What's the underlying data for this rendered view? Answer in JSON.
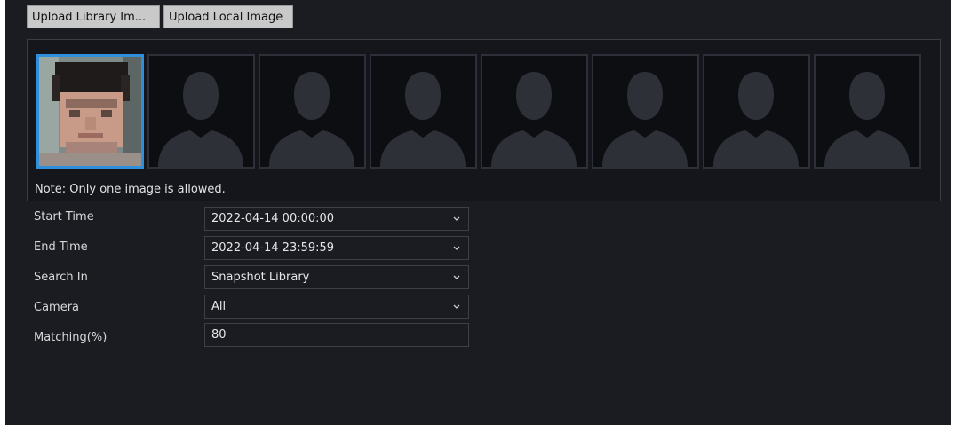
{
  "toolbar": {
    "upload_library_label": "Upload Library Im...",
    "upload_local_label": "Upload Local Image"
  },
  "gallery": {
    "note": "Note: Only one image is allowed.",
    "slots": [
      {
        "state": "selected-face"
      },
      {
        "state": "empty"
      },
      {
        "state": "empty"
      },
      {
        "state": "empty"
      },
      {
        "state": "empty"
      },
      {
        "state": "empty"
      },
      {
        "state": "empty"
      },
      {
        "state": "empty"
      }
    ]
  },
  "form": {
    "start_time": {
      "label": "Start Time",
      "value": "2022-04-14 00:00:00"
    },
    "end_time": {
      "label": "End Time",
      "value": "2022-04-14 23:59:59"
    },
    "search_in": {
      "label": "Search In",
      "value": "Snapshot Library"
    },
    "camera": {
      "label": "Camera",
      "value": "All"
    },
    "matching": {
      "label": "Matching(%)",
      "value": "80"
    }
  },
  "colors": {
    "panel_bg": "#1b1c22",
    "selection_accent": "#2f8fdb",
    "button_bg": "#c9c9c9"
  },
  "icons": [
    "chevron-down-icon",
    "person-silhouette-icon"
  ]
}
